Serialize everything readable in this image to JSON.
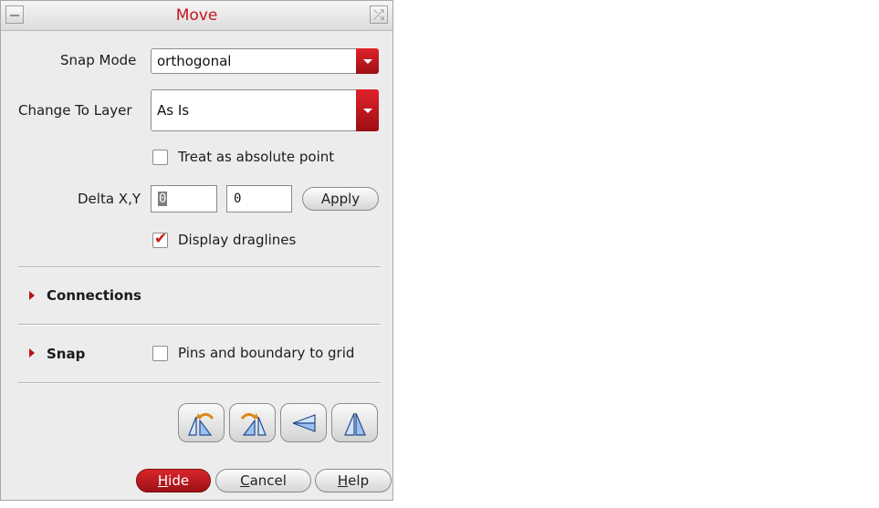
{
  "window": {
    "title": "Move"
  },
  "snap_mode": {
    "label": "Snap Mode",
    "value": "orthogonal"
  },
  "change_layer": {
    "label": "Change To Layer",
    "value": "As Is"
  },
  "absolute_point": {
    "label": "Treat as absolute point",
    "checked": false
  },
  "delta": {
    "label": "Delta X,Y",
    "x_value": "0",
    "y_value": "0",
    "apply_label": "Apply"
  },
  "draglines": {
    "label": "Display draglines",
    "checked": true
  },
  "connections": {
    "label": "Connections"
  },
  "snap": {
    "label": "Snap",
    "pins_label": "Pins and boundary to grid",
    "pins_checked": false
  },
  "transform_buttons": [
    {
      "icon": "rotate-left-icon"
    },
    {
      "icon": "rotate-right-icon"
    },
    {
      "icon": "flip-vertical-icon"
    },
    {
      "icon": "flip-horizontal-icon"
    }
  ],
  "footer": {
    "hide_label": {
      "mnemonic": "H",
      "rest": "ide"
    },
    "cancel_label": {
      "mnemonic": "C",
      "rest": "ancel"
    },
    "help_label": {
      "mnemonic": "H",
      "rest": "elp"
    }
  },
  "colors": {
    "accent": "#c4161c",
    "background": "#ececec"
  }
}
